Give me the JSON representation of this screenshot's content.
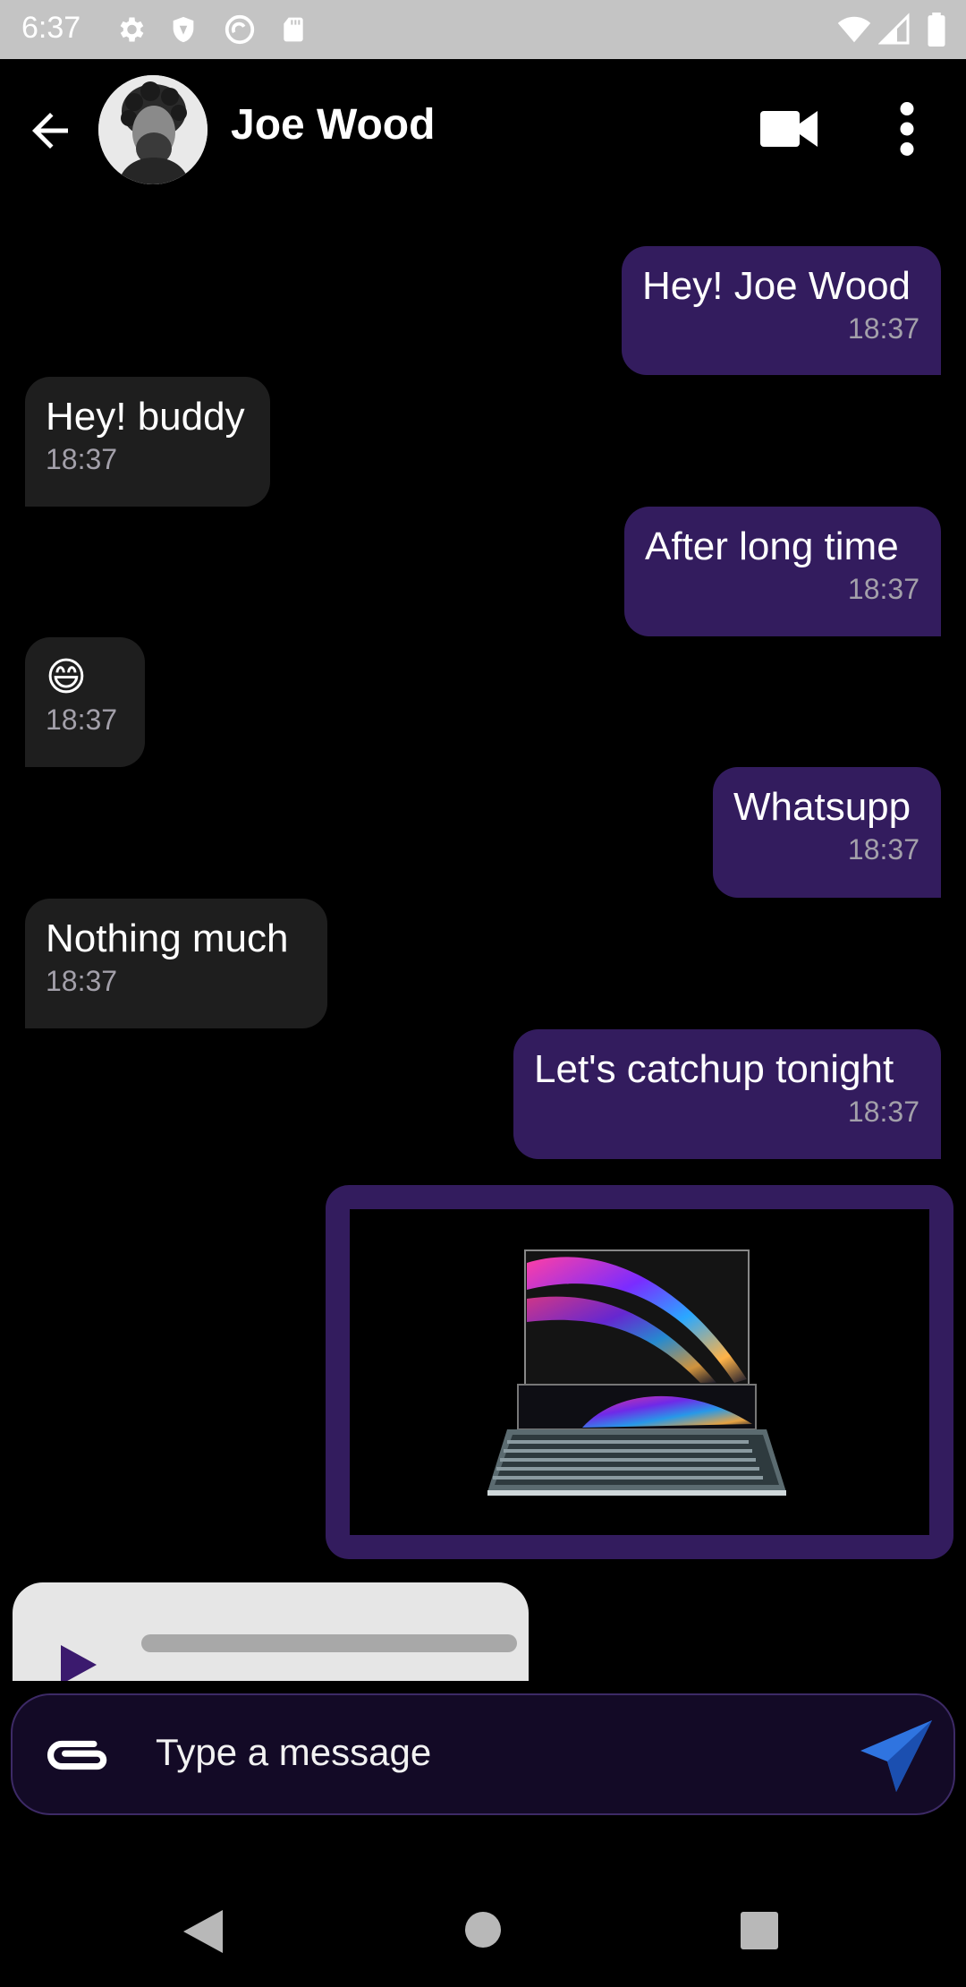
{
  "status_bar": {
    "time": "6:37",
    "left_icons": [
      "settings-icon",
      "shield-icon",
      "sync-icon",
      "sd-card-icon"
    ],
    "right_icons": [
      "wifi-icon",
      "signal-icon",
      "battery-icon"
    ]
  },
  "header": {
    "contact_name": "Joe Wood",
    "icons": [
      "back-arrow-icon",
      "video-call-icon",
      "more-vert-icon"
    ]
  },
  "messages": [
    {
      "direction": "sent",
      "text": "Hey! Joe Wood",
      "time": "18:37"
    },
    {
      "direction": "received",
      "text": "Hey! buddy",
      "time": "18:37"
    },
    {
      "direction": "sent",
      "text": "After long time",
      "time": "18:37"
    },
    {
      "direction": "received",
      "text": "😄",
      "time": "18:37"
    },
    {
      "direction": "sent",
      "text": "Whatsupp",
      "time": "18:37"
    },
    {
      "direction": "received",
      "text": "Nothing much",
      "time": "18:37"
    },
    {
      "direction": "sent",
      "text": "Let's catchup tonight",
      "time": "18:37"
    }
  ],
  "image_message": {
    "direction": "sent",
    "content": "laptop-image"
  },
  "audio_message": {
    "direction": "received",
    "icon": "play-icon"
  },
  "composer": {
    "placeholder": "Type a message",
    "attach_icon": "paperclip-icon",
    "send_icon": "send-icon"
  },
  "colors": {
    "sent_bubble": "#331c5e",
    "received_bubble": "#1e1e1e",
    "composer_bg": "#130a26",
    "send_button": "#2f74e0"
  },
  "nav_bar": {
    "icons": [
      "nav-back-icon",
      "nav-home-icon",
      "nav-recents-icon"
    ]
  }
}
